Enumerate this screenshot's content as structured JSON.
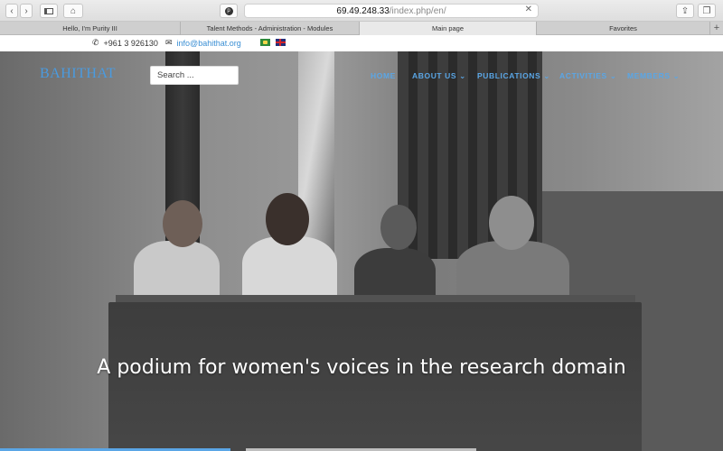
{
  "browser": {
    "url_host": "69.49.248.33",
    "url_path": "/index.php/en/",
    "tabs": [
      {
        "label": "Hello, I'm Purity III",
        "active": false
      },
      {
        "label": "Talent Methods - Administration - Modules",
        "active": false
      },
      {
        "label": "Main page",
        "active": true
      },
      {
        "label": "Favorites",
        "active": false
      }
    ],
    "new_tab": "+"
  },
  "contact": {
    "phone": "+961 3 926130",
    "email": "info@bahithat.org",
    "languages": [
      "arabic-flag",
      "english-flag"
    ]
  },
  "header": {
    "logo": "BAHITHAT",
    "search_placeholder": "Search ...",
    "nav": [
      {
        "label": "HOME",
        "has_dropdown": false
      },
      {
        "label": "ABOUT US",
        "has_dropdown": true
      },
      {
        "label": "PUBLICATIONS",
        "has_dropdown": true
      },
      {
        "label": "ACTIVITIES",
        "has_dropdown": true
      },
      {
        "label": "MEMBERS",
        "has_dropdown": true
      }
    ]
  },
  "hero": {
    "caption": "A podium for women's voices in the research domain"
  },
  "colors": {
    "accent": "#4a9be0",
    "nav": "#5aa6e6"
  }
}
